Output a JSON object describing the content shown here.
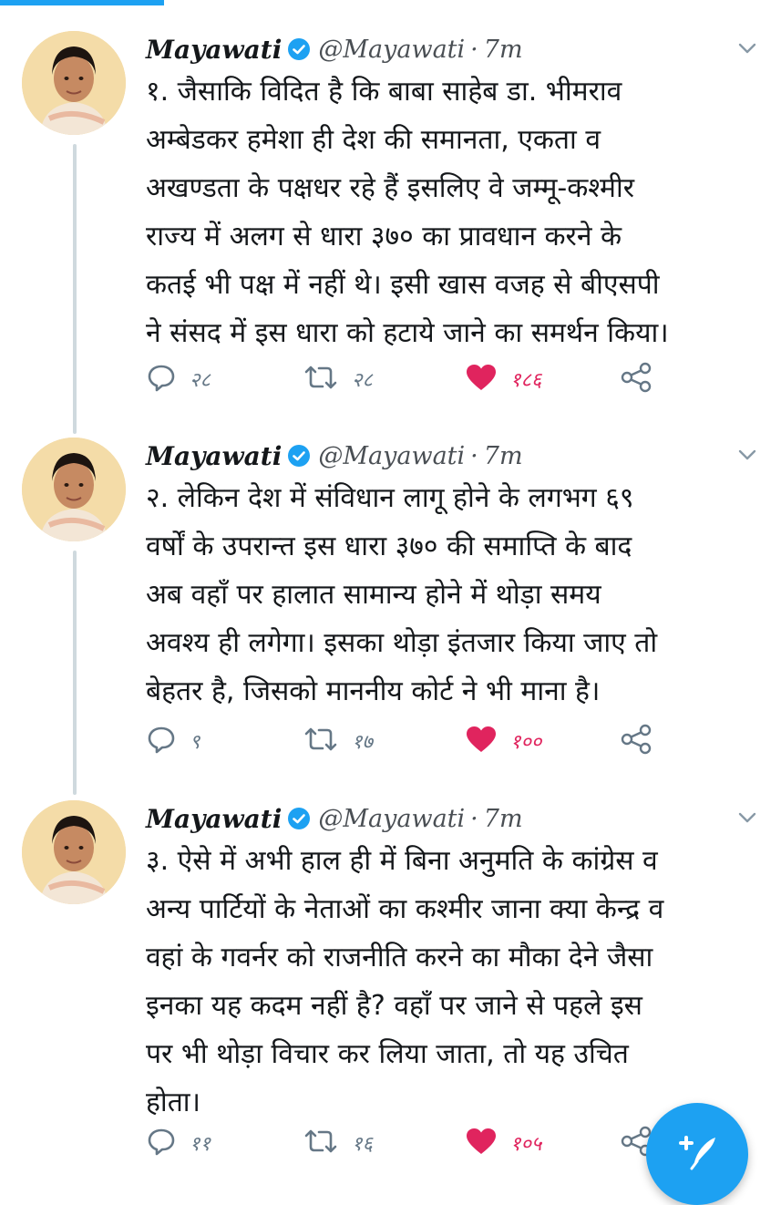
{
  "progress": {
    "fraction": 0.21,
    "color": "#1da1f2"
  },
  "colors": {
    "verified": "#1da1f2",
    "like": "#e0245e",
    "icon": "#657786",
    "text": "#14171a"
  },
  "tweets": [
    {
      "author": "Mayawati",
      "handle": "@Mayawati",
      "separator": "·",
      "time": "7m",
      "text": "१. जैसाकि विदित है कि बाबा साहेब डा. भीमराव\nअम्बेडकर हमेशा ही देश की समानता, एकता व\nअखण्डता के पक्षधर रहे हैं इसलिए वे जम्मू-कश्मीर\nराज्य में अलग से धारा ३७० का प्रावधान करने के\nकतई भी पक्ष में नहीं थे। इसी खास वजह से बीएसपी\nने संसद में इस धारा को हटाये जाने का समर्थन किया।",
      "replies": "२८",
      "retweets": "२८",
      "likes": "१८६",
      "liked": true,
      "icons": [
        "reply-icon",
        "retweet-icon",
        "heart-icon",
        "share-icon"
      ]
    },
    {
      "author": "Mayawati",
      "handle": "@Mayawati",
      "separator": "·",
      "time": "7m",
      "text": "२. लेकिन देश में संविधान लागू होने के लगभग ६९\nवर्षों के उपरान्त इस धारा ३७० की समाप्ति के बाद\nअब वहाँ पर हालात सामान्य होने में थोड़ा समय\nअवश्य ही लगेगा। इसका थोड़ा इंतजार किया जाए तो\nबेहतर है, जिसको माननीय कोर्ट ने भी माना है।",
      "replies": "९",
      "retweets": "१७",
      "likes": "१००",
      "liked": true,
      "icons": [
        "reply-icon",
        "retweet-icon",
        "heart-icon",
        "share-icon"
      ]
    },
    {
      "author": "Mayawati",
      "handle": "@Mayawati",
      "separator": "·",
      "time": "7m",
      "text": "३. ऐसे में अभी हाल ही में बिना अनुमति के कांग्रेस व\nअन्य पार्टियों के नेताओं का कश्मीर जाना क्या केन्द्र व\nवहां के गवर्नर को राजनीति करने का मौका देने जैसा\nइनका यह कदम नहीं है? वहाँ पर जाने से पहले इस\nपर भी थोड़ा विचार कर लिया जाता, तो यह उचित\nहोता।",
      "replies": "११",
      "retweets": "१६",
      "likes": "१०५",
      "liked": true,
      "icons": [
        "reply-icon",
        "retweet-icon",
        "heart-icon",
        "share-icon"
      ]
    }
  ],
  "fab": {
    "icon": "compose-tweet-icon"
  }
}
